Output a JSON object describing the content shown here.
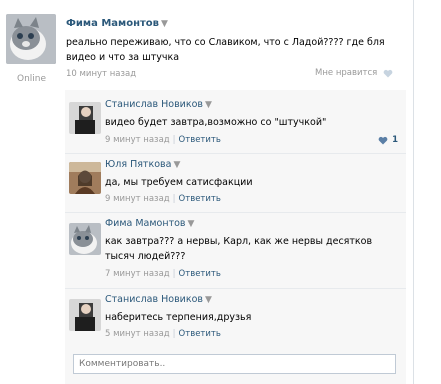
{
  "post": {
    "author": "Фима Мамонтов",
    "status": "Online",
    "text": "реально переживаю, что со Славиком, что с Ладой???? где бля видео и что за штучка",
    "time": "10 минут назад",
    "like_label": "Мне нравится"
  },
  "comments": [
    {
      "author": "Станислав Новиков",
      "text": "видео будет завтра,возможно со \"штучкой\"",
      "time": "9 минут назад",
      "reply_label": "Ответить",
      "likes": "1"
    },
    {
      "author": "Юля Пяткова",
      "text": "да, мы требуем сатисфакции",
      "time": "9 минут назад",
      "reply_label": "Ответить"
    },
    {
      "author": "Фима Мамонтов",
      "text": "как завтра??? а нервы, Карл, как же нервы десятков тысяч людей???",
      "time": "7 минут назад",
      "reply_label": "Ответить"
    },
    {
      "author": "Станислав Новиков",
      "text": "наберитесь терпения,друзья",
      "time": "5 минут назад",
      "reply_label": "Ответить"
    }
  ],
  "comment_input": {
    "placeholder": "Комментировать.."
  },
  "icons": {
    "caret": "chevron-down-icon",
    "like": "heart-icon"
  },
  "colors": {
    "link": "#2b587a",
    "muted": "#999999",
    "comment_bg": "#f7f7f7",
    "heart": "#c7d4e0"
  }
}
